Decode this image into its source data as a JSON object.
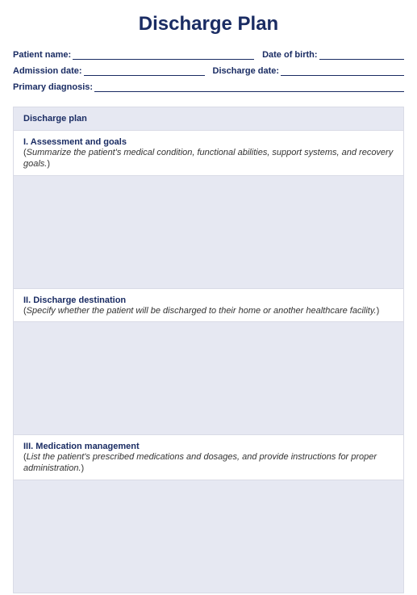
{
  "title": "Discharge Plan",
  "info": {
    "row1": {
      "patient_name_label": "Patient name:",
      "dob_label": "Date of birth:"
    },
    "row2": {
      "admission_label": "Admission date:",
      "discharge_label": "Discharge date:"
    },
    "row3": {
      "primary_dx_label": "Primary diagnosis:"
    }
  },
  "plan": {
    "header": "Discharge plan",
    "sections": [
      {
        "title": "I. Assessment and goals",
        "instruction": "Summarize the patient's medical condition, functional abilities, support systems, and recovery goals."
      },
      {
        "title": "II. Discharge destination",
        "instruction": "Specify whether the patient will be discharged to their home or another healthcare facility."
      },
      {
        "title": "III. Medication management",
        "instruction": "List the patient's prescribed medications and dosages, and provide instructions for proper administration."
      }
    ]
  }
}
